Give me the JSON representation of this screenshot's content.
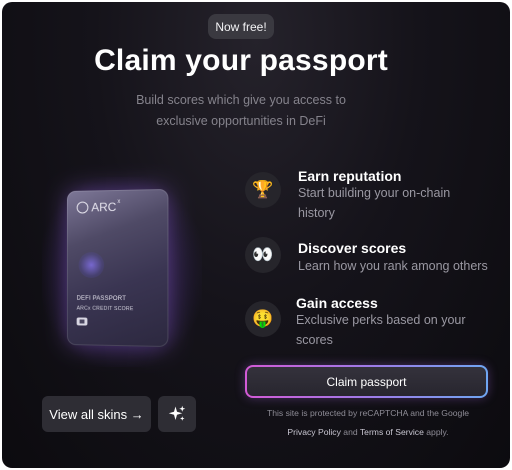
{
  "header": {
    "badge": "Now free!",
    "title": "Claim your passport",
    "subtitle": "Build scores which give you access to exclusive opportunities in DeFi"
  },
  "card": {
    "logo_text": "ARC",
    "logo_superscript": "x",
    "line1": "DEFI PASSPORT",
    "line2": "ARCx CREDIT SCORE"
  },
  "features": [
    {
      "icon": "trophy-icon",
      "emoji": "🏆",
      "title": "Earn reputation",
      "description": "Start building your on-chain history"
    },
    {
      "icon": "eyes-icon",
      "emoji": "👀",
      "title": "Discover scores",
      "description": "Learn how you rank among others"
    },
    {
      "icon": "money-face-icon",
      "emoji": "🤑",
      "title": "Gain access",
      "description": "Exclusive perks based on your scores"
    }
  ],
  "actions": {
    "view_skins_label": "View all skins →",
    "sparkle_icon": "sparkle-icon",
    "claim_label": "Claim passport"
  },
  "recaptcha": {
    "line1": "This site is protected by reCAPTCHA and the Google",
    "privacy_link": "Privacy Policy",
    "and_text": "and",
    "terms_link": "Terms of Service",
    "apply_text": "apply."
  },
  "colors": {
    "background": "#0c0b0f",
    "button_bg": "#2e2d34",
    "gradient_start": "#d35ad6",
    "gradient_end": "#6fa6f2",
    "muted_text": "#9a98a2"
  }
}
